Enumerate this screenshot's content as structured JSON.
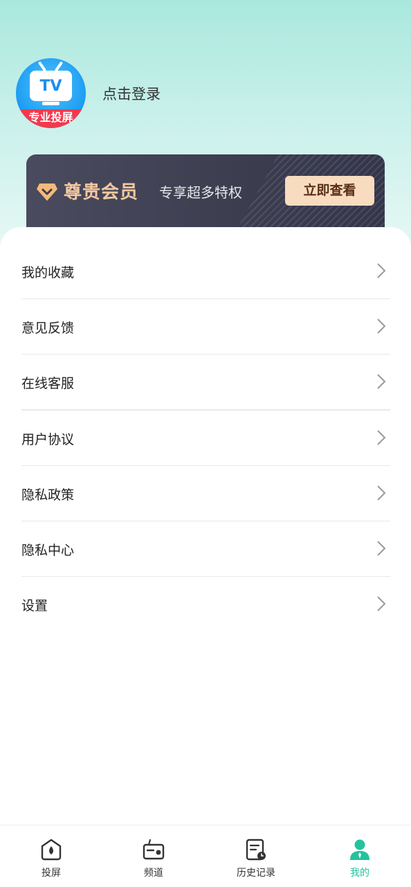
{
  "profile": {
    "avatar_screen_text": "TV",
    "avatar_ribbon_text": "专业投屏",
    "login_text": "点击登录"
  },
  "vip": {
    "title": "尊贵会员",
    "subtitle": "专享超多特权",
    "button_label": "立即查看",
    "colors": {
      "title": "#f5c9a0",
      "button_bg": "#f8dcc0"
    }
  },
  "menu": {
    "items": [
      {
        "label": "我的收藏"
      },
      {
        "label": "意见反馈"
      },
      {
        "label": "在线客服"
      },
      {
        "label": "用户协议"
      },
      {
        "label": "隐私政策"
      },
      {
        "label": "隐私中心"
      },
      {
        "label": "设置"
      }
    ]
  },
  "tabbar": {
    "tabs": [
      {
        "label": "投屏",
        "icon": "cast-icon"
      },
      {
        "label": "频道",
        "icon": "radio-icon"
      },
      {
        "label": "历史记录",
        "icon": "history-icon"
      },
      {
        "label": "我的",
        "icon": "user-icon",
        "active": true
      }
    ],
    "active_color": "#22c39d"
  }
}
